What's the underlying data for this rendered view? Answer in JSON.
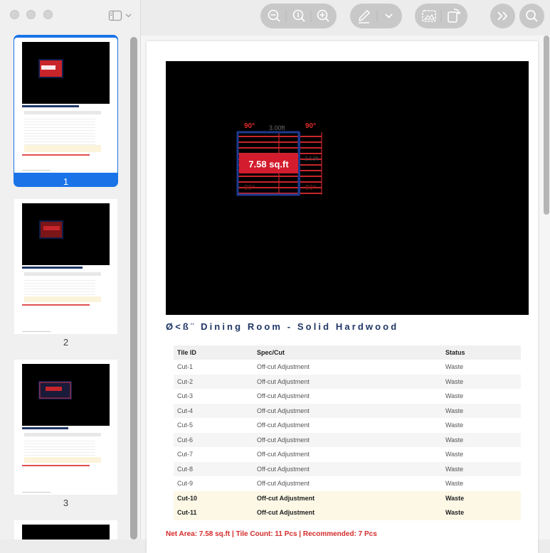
{
  "window": {
    "traffic_lights": [
      "close",
      "minimize",
      "zoom"
    ]
  },
  "sidebar": {
    "thumbnails": [
      {
        "page": "1",
        "selected": true
      },
      {
        "page": "2",
        "selected": false
      },
      {
        "page": "3",
        "selected": false
      }
    ]
  },
  "toolbar": {
    "icons": [
      "sidebar-toggle-icon",
      "zoom-out-icon",
      "actual-size-icon",
      "zoom-in-icon",
      "pen-markup-icon",
      "chevron-down-icon",
      "image-markup-icon",
      "rotate-icon",
      "forward-icon",
      "search-icon"
    ]
  },
  "plan": {
    "angle_tl": "90°",
    "angle_tr": "90°",
    "angle_bl": "90°",
    "angle_br": "90°",
    "width_label": "3.00ft",
    "height_label": "2.53ft",
    "area_badge": "7.58 sq.ft",
    "colors": {
      "tile_stroke": "#c8252b",
      "outline": "#1d3a8f",
      "badge": "#d31c2d"
    }
  },
  "page_title": "Ø<ß¨ Dining Room - Solid Hardwood",
  "table": {
    "headers": [
      "Tile ID",
      "Spec/Cut",
      "Status"
    ],
    "rows": [
      [
        "Cut-1",
        "Off-cut Adjustment",
        "Waste"
      ],
      [
        "Cut-2",
        "Off-cut Adjustment",
        "Waste"
      ],
      [
        "Cut-3",
        "Off-cut Adjustment",
        "Waste"
      ],
      [
        "Cut-4",
        "Off-cut Adjustment",
        "Waste"
      ],
      [
        "Cut-5",
        "Off-cut Adjustment",
        "Waste"
      ],
      [
        "Cut-6",
        "Off-cut Adjustment",
        "Waste"
      ],
      [
        "Cut-7",
        "Off-cut Adjustment",
        "Waste"
      ],
      [
        "Cut-8",
        "Off-cut Adjustment",
        "Waste"
      ],
      [
        "Cut-9",
        "Off-cut Adjustment",
        "Waste"
      ],
      [
        "Cut-10",
        "Off-cut Adjustment",
        "Waste"
      ],
      [
        "Cut-11",
        "Off-cut Adjustment",
        "Waste"
      ]
    ]
  },
  "summary": "Net Area: 7.58 sq.ft | Tile Count: 11 Pcs | Recommended: 7 Pcs"
}
